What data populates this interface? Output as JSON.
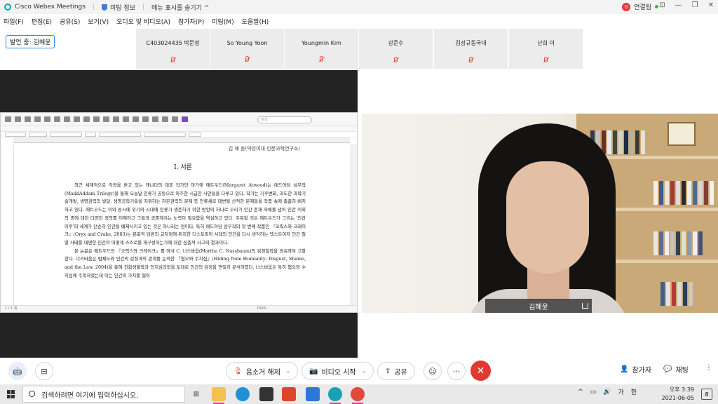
{
  "titlebar": {
    "app_title": "Cisco Webex Meetings",
    "meeting_info": "미팅 정보",
    "hide_menu": "메뉴 표시줄 숨기기 ^",
    "recording_count": "0",
    "connection_label": "연결됨"
  },
  "menu": {
    "items": [
      "파일(F)",
      "편집(E)",
      "공유(S)",
      "보기(V)",
      "오디오 및 비디오(A)",
      "참가자(P)",
      "미팅(M)",
      "도움말(H)"
    ]
  },
  "speaking": {
    "label": "발언 중: 김혜윤"
  },
  "participants": [
    {
      "name": "C403024435 박문정"
    },
    {
      "name": "So Young Yoon"
    },
    {
      "name": "Youngmin Kim"
    },
    {
      "name": "강준수"
    },
    {
      "name": "김성규동국대"
    },
    {
      "name": "난희 이"
    }
  ],
  "document": {
    "search_placeholder": "검색",
    "header_right": "김 혜 윤(덕성여대 인문과학연구소)",
    "section_title": "Ⅰ. 서론",
    "paragraphs": [
      "최근 세계적으로 각광을 받고 있는 캐나다의 대표 작가인 마가렛 애트우드(Margaret Atwood)는 매드아담 삼부작(MaddAddam Trilogy)을 통해 오늘날 인류가 공동으로 마주한 시급한 사안들을 다루고 있다. 작가는 기후변화, 과도한 과학기술개발, 생명권력의 발달, 생명공학기술을 지휘하는 자본권력의 문제 등 인류세로 대변될 산적한 문제들을 작품 속에 촘촘히 배치하고 있다. 애트우드는 이와 동시에 위기의 시대에 인류가 생존하기 위한 방안의 하나로 우리가 인간 존재 자체를 넘어 인간 이외의 종에 대한 다양한 정의를 이해하고 그들과 공존하려는 노력이 필요함을 역설하고 있다. 주목할 것은 애트우드가 그리는 '인간 이후'의 세계가 단순히 인간을 배제시키고 있는 것은 아니라는 점이다. 특히 매드아담 삼부작의 첫 번째 작품인 『오릭스와 크레이크』(Oryx and Crake, 2003)는 문화적 담론의 교차점에 위치한 디스토피아 시대의 인간을 다시 생각하는 텍스트이자 인간 절멸 사태를 대면한 인간이 어떻게 스스로를 재구성하는가에 대한 심층적 사고의 결과이다.",
      "본 논문은 애트우드의 『오릭스와 크레이크』를 마사 C. 너스바움(Martha C. Nussbaum)의 감정철학을 경유하여 고찰한다. 너스바움은 법체도와 인간의 감정과의 관계를 논의한 『혐오와 수치심』(Hiding from Humanity: Disgust, Shame, and the Law, 2004)을 통해 진화생물학과 인지심리학을 토대로 인간의 감정을 면밀히 분석하였다. 너스바움은 특히 혐오와 수치심에 주목하였는데 이는 인간의 가치를 떨어"
    ],
    "status_left": "1 / 1 쪽",
    "zoom": "150%"
  },
  "video": {
    "name": "김혜윤"
  },
  "controls": {
    "mute_label": "음소거 해제",
    "video_label": "비디오 시작",
    "share_label": "공유",
    "more_label": "···",
    "participants_label": "참가자",
    "chat_label": "채팅",
    "end_icon": "✕"
  },
  "taskbar": {
    "search_placeholder": "검색하려면 여기에 입력하십시오.",
    "time": "오후 3:39",
    "date": "2021-06-05",
    "ime": "가",
    "lang": "한",
    "notif_count": "8"
  },
  "colors": {
    "accent": "#2e8be6",
    "end_call": "#e0392f",
    "muted": "#d93a3a",
    "dark_stage": "#232323"
  }
}
